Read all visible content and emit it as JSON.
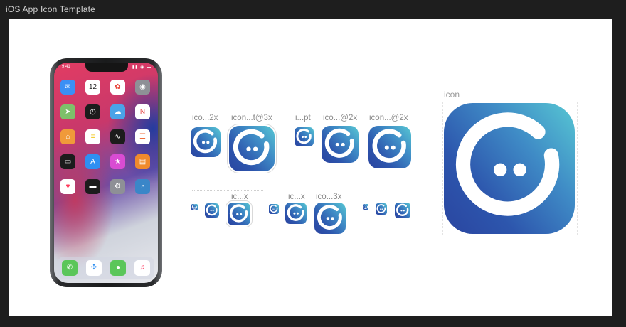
{
  "window": {
    "title": "iOS App Icon Template"
  },
  "phone": {
    "status_time": "9:41",
    "status_icons": "▮▮ ◉ ▬",
    "apps": [
      {
        "name": "mail-icon",
        "glyph": "✉",
        "color": "#3b8ff5"
      },
      {
        "name": "calendar-icon",
        "glyph": "12",
        "color": "#ffffff",
        "text": "#222222"
      },
      {
        "name": "photos-icon",
        "glyph": "✿",
        "color": "#ffffff",
        "text": "#e8463c"
      },
      {
        "name": "camera-icon",
        "glyph": "◉",
        "color": "#8e9096"
      },
      {
        "name": "maps-icon",
        "glyph": "➤",
        "color": "#7ec06a"
      },
      {
        "name": "clock-icon",
        "glyph": "◷",
        "color": "#1c1c1c"
      },
      {
        "name": "weather-icon",
        "glyph": "☁",
        "color": "#4aa3e8"
      },
      {
        "name": "news-icon",
        "glyph": "N",
        "color": "#ffffff",
        "text": "#e23a3a"
      },
      {
        "name": "home-icon",
        "glyph": "⌂",
        "color": "#f09a3a"
      },
      {
        "name": "notes-icon",
        "glyph": "≡",
        "color": "#ffffff",
        "text": "#f0c000"
      },
      {
        "name": "stocks-icon",
        "glyph": "∿",
        "color": "#1c1c1c"
      },
      {
        "name": "reminders-icon",
        "glyph": "☰",
        "color": "#ffffff",
        "text": "#ef6b3a"
      },
      {
        "name": "tv-icon",
        "glyph": "▭",
        "color": "#1c1c1c"
      },
      {
        "name": "app-store-icon",
        "glyph": "A",
        "color": "#2f8ff2"
      },
      {
        "name": "itunes-store-icon",
        "glyph": "★",
        "color": "#d94cd3"
      },
      {
        "name": "books-icon",
        "glyph": "▤",
        "color": "#f08a2c"
      },
      {
        "name": "health-icon",
        "glyph": "♥",
        "color": "#ffffff",
        "text": "#ff3b5c"
      },
      {
        "name": "wallet-icon",
        "glyph": "▬",
        "color": "#1c1c1c"
      },
      {
        "name": "settings-icon",
        "glyph": "⚙",
        "color": "#8e9096"
      },
      {
        "name": "custom-app-icon",
        "glyph": "◔",
        "color": "#3a86c8"
      }
    ],
    "dock": [
      {
        "name": "phone-icon",
        "glyph": "✆",
        "color": "#5bc65a"
      },
      {
        "name": "safari-icon",
        "glyph": "✣",
        "color": "#ffffff",
        "text": "#2f8ff2"
      },
      {
        "name": "messages-icon",
        "glyph": "●",
        "color": "#5bc65a"
      },
      {
        "name": "music-icon",
        "glyph": "♫",
        "color": "#ffffff",
        "text": "#ff2d55"
      }
    ]
  },
  "labels": {
    "row1_a": "ico...2x",
    "row1_b": "icon...t@3x",
    "row1_c": "i...pt",
    "row1_d": "ico...@2x",
    "row1_e": "icon...@2x",
    "row2_a": "ic...x",
    "row2_b": "ic...x",
    "row2_c": "ico...3x",
    "big": "icon"
  },
  "colors": {
    "icon_light": "#57c7d3",
    "icon_dark": "#2a45a0",
    "canvas": "#1e1e1e",
    "artboard": "#ffffff"
  }
}
